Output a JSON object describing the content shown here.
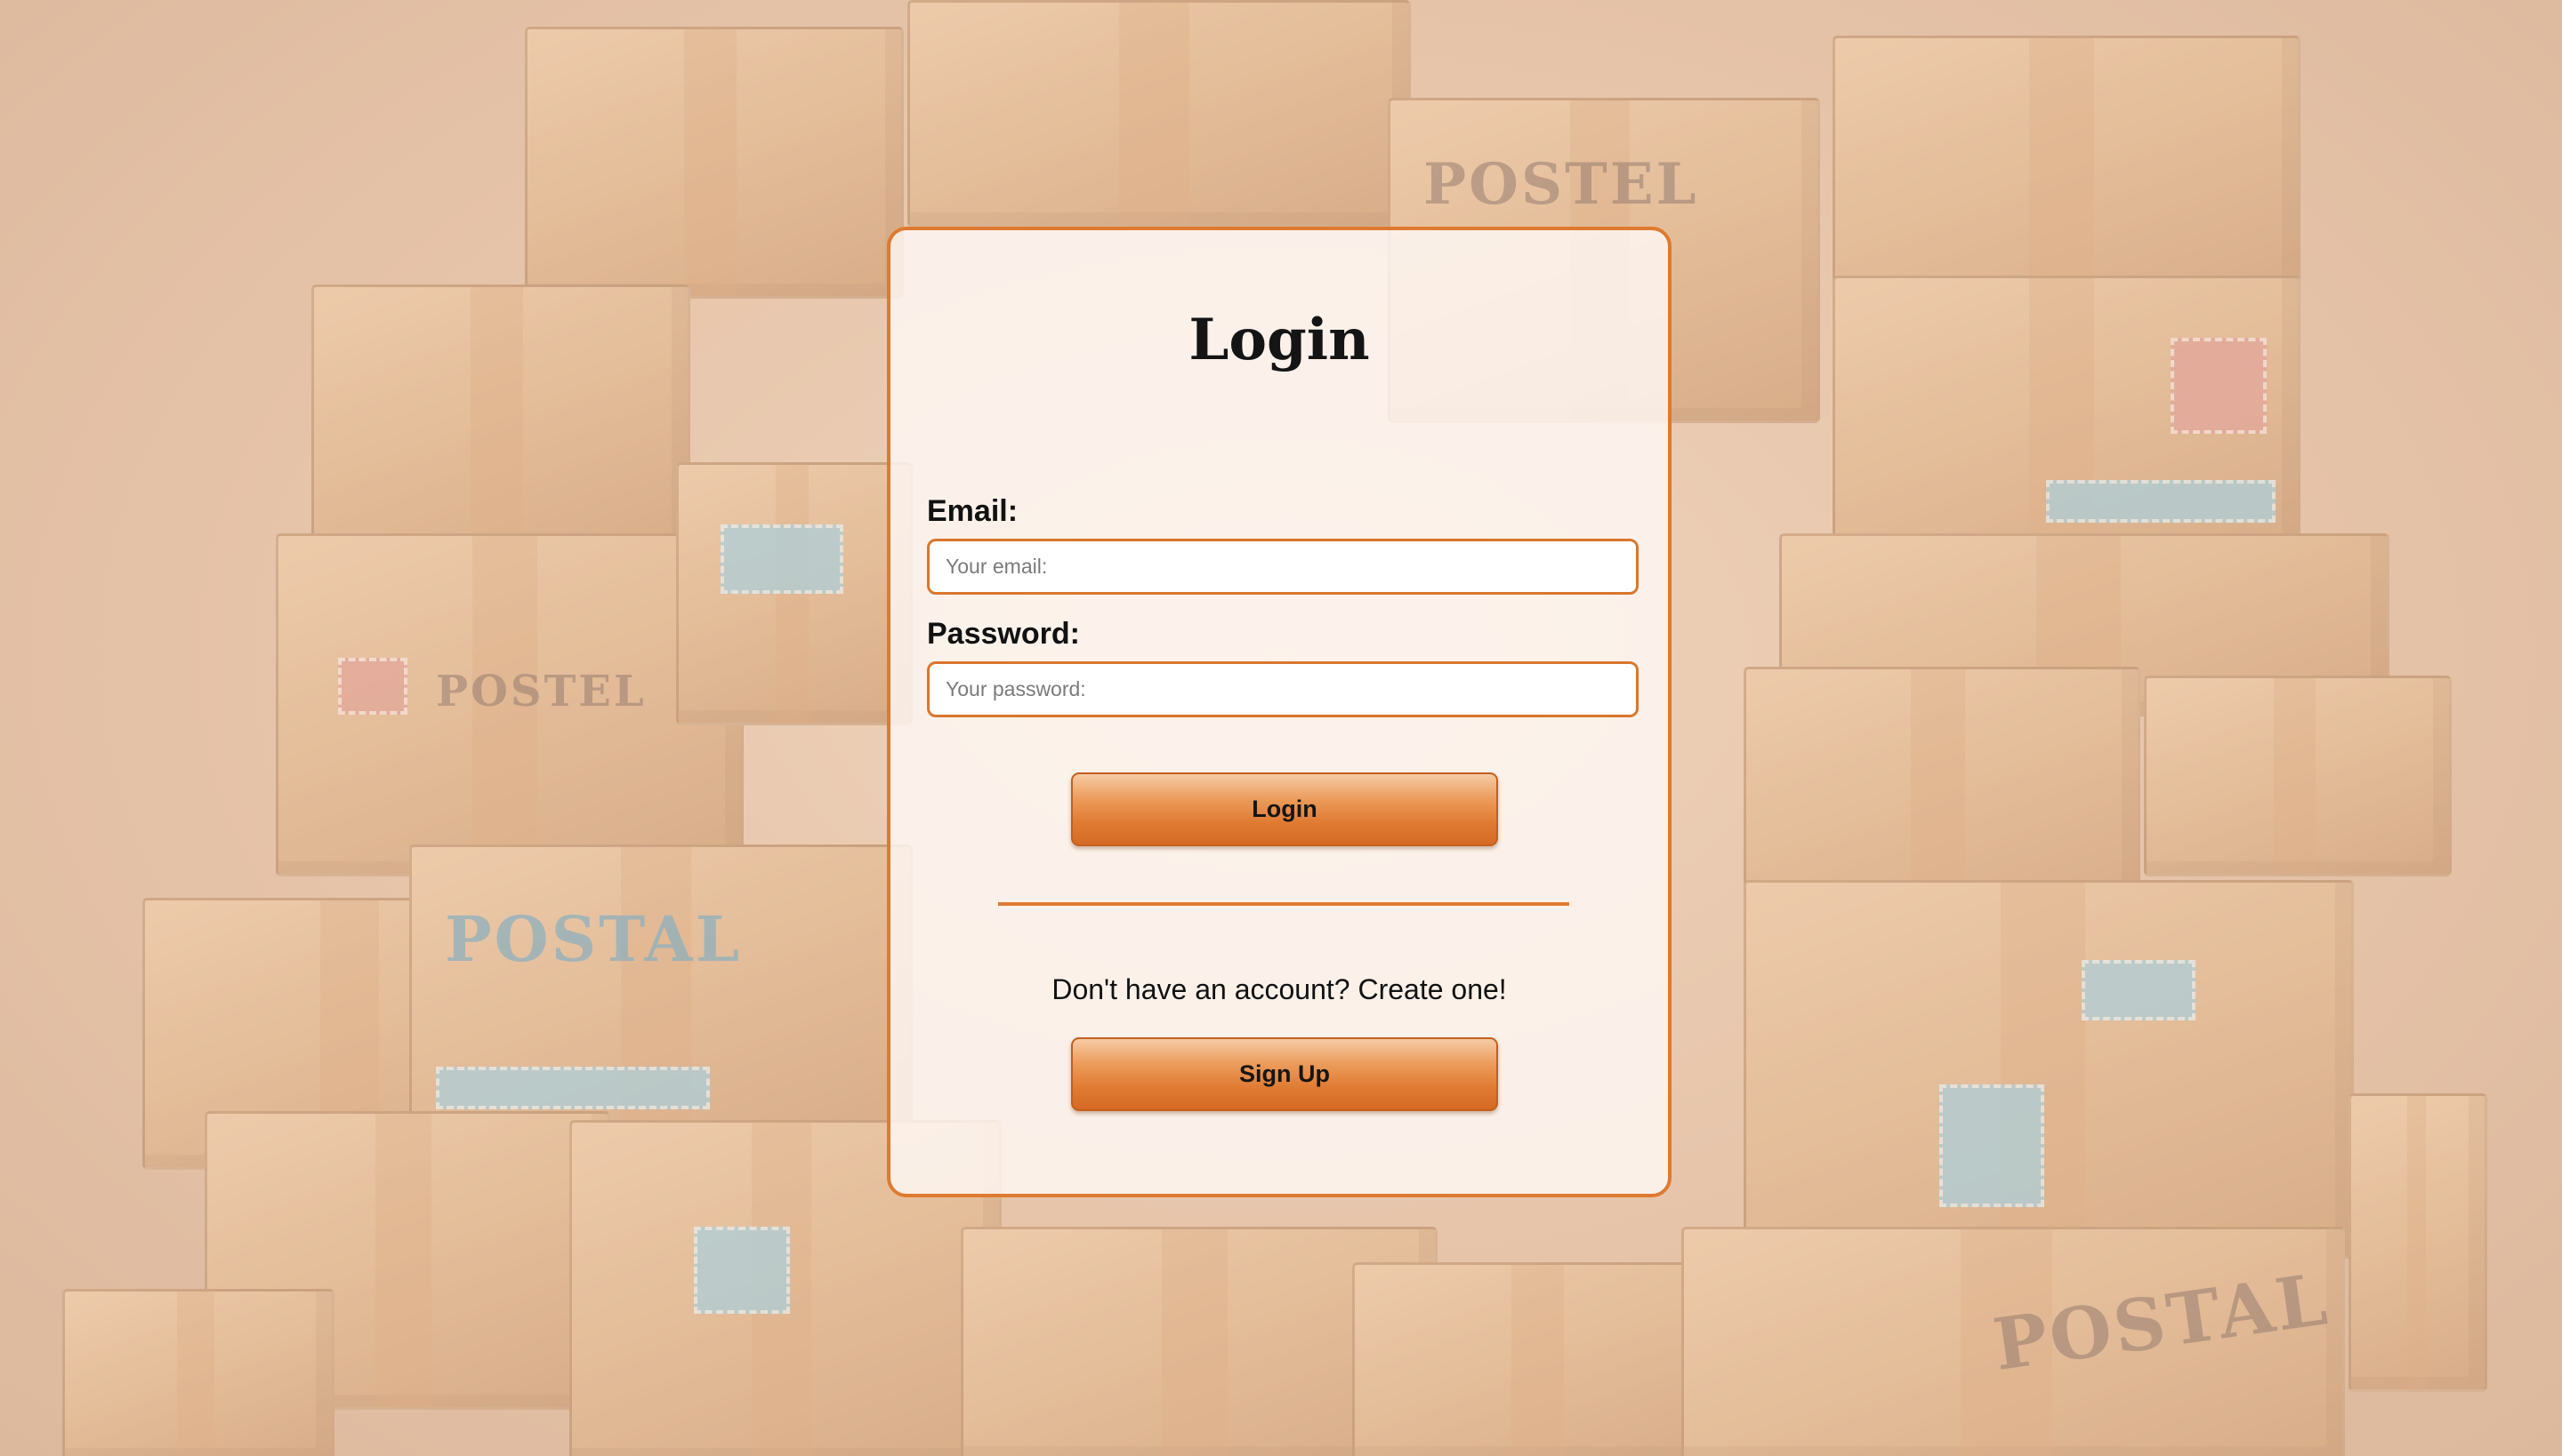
{
  "login": {
    "title": "Login",
    "email_label": "Email:",
    "email_value": "",
    "email_placeholder": "Your email:",
    "password_label": "Password:",
    "password_value": "",
    "password_placeholder": "Your password:",
    "login_button": "Login",
    "signup_prompt": "Don't have an account? Create one!",
    "signup_button": "Sign Up"
  },
  "background": {
    "words": [
      "POSTEL",
      "POSTEL",
      "POSTAL",
      "POSTAL"
    ]
  },
  "colors": {
    "accent": "#de7a30",
    "button_gradient_top": "#f6cba5",
    "button_gradient_bottom": "#d56a24",
    "card_background": "#fffaf8",
    "background_tone": "#e3c2a6"
  }
}
